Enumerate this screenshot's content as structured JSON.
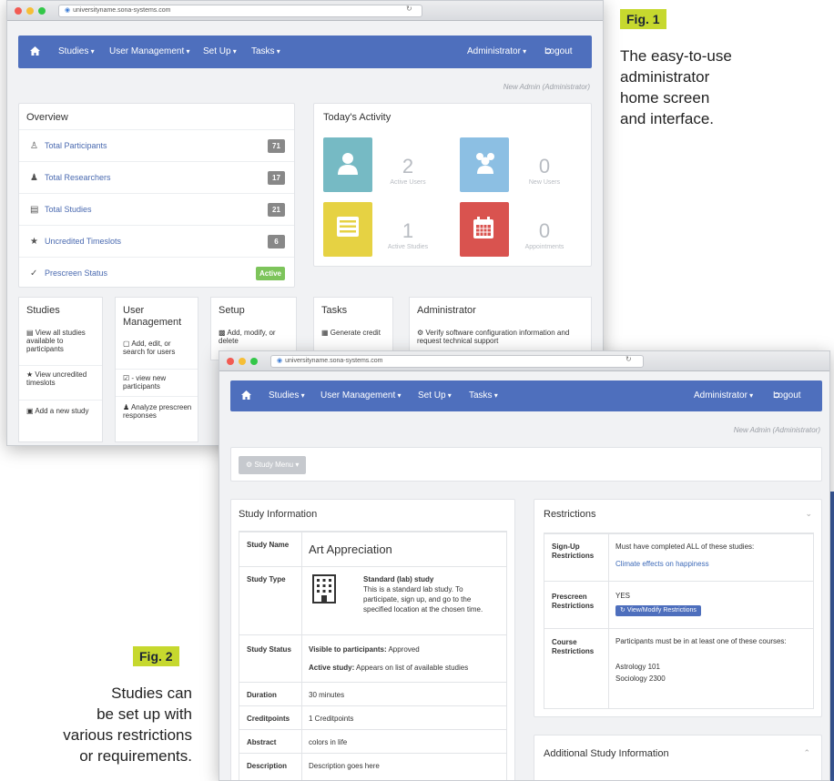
{
  "figures": {
    "fig1": {
      "label": "Fig. 1",
      "caption": [
        "The easy-to-use",
        "administrator",
        "home screen",
        "and interface."
      ]
    },
    "fig2": {
      "label": "Fig. 2",
      "caption": [
        "Studies can",
        "be set up with",
        "various restrictions",
        "or requirements."
      ]
    }
  },
  "shared": {
    "url": "universityname.sona-systems.com",
    "nav": {
      "studies": "Studies",
      "user_management": "User Management",
      "set_up": "Set Up",
      "tasks": "Tasks",
      "administrator": "Administrator",
      "logout": "Logout"
    },
    "admin_line": "New Admin (Administrator)"
  },
  "overview": {
    "title": "Overview",
    "rows": [
      {
        "label": "Total Participants",
        "badge": "71",
        "icon": "user-icon"
      },
      {
        "label": "Total Researchers",
        "badge": "17",
        "icon": "users-icon"
      },
      {
        "label": "Total Studies",
        "badge": "21",
        "icon": "list-icon"
      },
      {
        "label": "Uncredited Timeslots",
        "badge": "6",
        "icon": "star-icon"
      },
      {
        "label": "Prescreen Status",
        "badge": "Active",
        "icon": "check-circle-icon"
      }
    ]
  },
  "activity": {
    "title": "Today's Activity",
    "tiles": [
      {
        "value": "2",
        "label": "Active Users",
        "color": "#76bac4",
        "icon": "user-icon"
      },
      {
        "value": "0",
        "label": "New Users",
        "color": "#8cbfe3",
        "icon": "users-icon"
      },
      {
        "value": "1",
        "label": "Active Studies",
        "color": "#e6d243",
        "icon": "list-icon"
      },
      {
        "value": "0",
        "label": "Appointments",
        "color": "#d9534f",
        "icon": "calendar-icon"
      }
    ]
  },
  "columns": {
    "studies": {
      "title": "Studies",
      "items": [
        "View all studies available to participants",
        "View uncredited timeslots",
        "Add a new study"
      ]
    },
    "user_management": {
      "title": "User Management",
      "items": [
        "Add, edit, or search for users",
        "- view new participants",
        "Analyze prescreen responses"
      ]
    },
    "setup": {
      "title": "Setup",
      "items": [
        "Add, modify, or delete"
      ]
    },
    "tasks": {
      "title": "Tasks",
      "items": [
        "Generate credit"
      ]
    },
    "administrator": {
      "title": "Administrator",
      "items": [
        "Verify software configuration information and request technical support"
      ]
    }
  },
  "study": {
    "menu_button": "Study Menu",
    "info_title": "Study Information",
    "rows": {
      "name": {
        "label": "Study Name",
        "value": "Art Appreciation"
      },
      "type": {
        "label": "Study Type",
        "title": "Standard (lab) study",
        "desc": "This is a standard lab study. To participate, sign up, and go to the specified location at the chosen time."
      },
      "status": {
        "label": "Study Status",
        "visible_label": "Visible to participants:",
        "visible_value": "Approved",
        "active_label": "Active study:",
        "active_value": "Appears on list of available studies"
      },
      "duration": {
        "label": "Duration",
        "value": "30 minutes"
      },
      "credits": {
        "label": "Creditpoints",
        "value": "1 Creditpoints"
      },
      "abstract": {
        "label": "Abstract",
        "value": "colors in life"
      },
      "description": {
        "label": "Description",
        "value": "Description goes here"
      }
    },
    "restrictions": {
      "title": "Restrictions",
      "signup": {
        "label": "Sign-Up Restrictions",
        "text": "Must have completed ALL of these studies:",
        "link": "Climate effects on happiness"
      },
      "prescreen": {
        "label": "Prescreen Restrictions",
        "value": "YES",
        "button": "View/Modify Restrictions"
      },
      "course": {
        "label": "Course Restrictions",
        "text": "Participants must be in at least one of these courses:",
        "courses": [
          "Astrology 101",
          "Sociology 2300"
        ]
      }
    },
    "additional_title": "Additional Study Information"
  }
}
